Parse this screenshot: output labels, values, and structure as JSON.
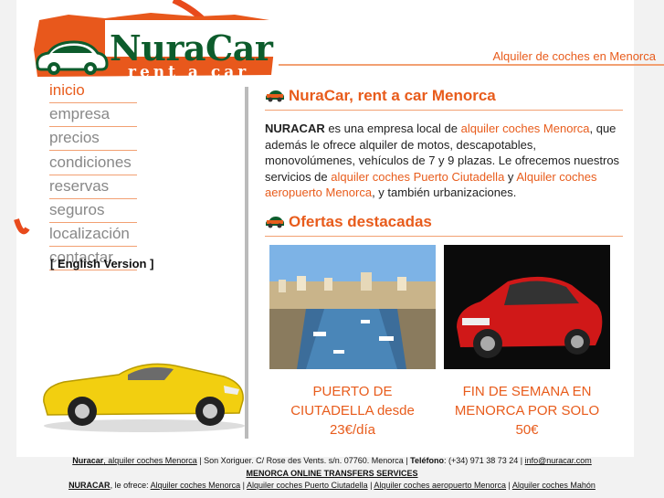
{
  "brand": {
    "name": "NuraCar",
    "subtitle": "rent a car"
  },
  "header": {
    "tagline": "Alquiler de coches en Menorca"
  },
  "menu": {
    "items": [
      {
        "label": "inicio",
        "active": true
      },
      {
        "label": "empresa",
        "active": false
      },
      {
        "label": "precios",
        "active": false
      },
      {
        "label": "condiciones",
        "active": false
      },
      {
        "label": "reservas",
        "active": false
      },
      {
        "label": "seguros",
        "active": false
      },
      {
        "label": "localización",
        "active": false
      },
      {
        "label": "contactar",
        "active": false
      }
    ],
    "english": "[ English Version ]"
  },
  "main": {
    "title": "NuraCar, rent a car Menorca",
    "intro": {
      "brand": "NURACAR",
      "t1": " es una empresa local de ",
      "l1": "alquiler coches Menorca",
      "t2": ", que además le ofrece alquiler de motos, descapotables, monovolúmenes, vehículos de 7 y 9 plazas. Le ofrecemos nuestros servicios de ",
      "l2": "alquiler coches Puerto Ciutadella",
      "t3": " y ",
      "l3": "Alquiler coches aeropuerto Menorca",
      "t4": ", y también urbanizaciones."
    }
  },
  "offers": {
    "title": "Ofertas destacadas",
    "items": [
      {
        "line1": "PUERTO DE",
        "line2": "CIUTADELLA desde",
        "price": "23€/día"
      },
      {
        "line1": "FIN DE SEMANA EN",
        "line2": "MENORCA POR SOLO",
        "price": "50€"
      }
    ]
  },
  "footer": {
    "line1": {
      "brand_link": "Nuracar",
      "brand_rest": ", alquiler coches Menorca",
      "address": " | Son Xoriguer. C/ Rose des Vents. s/n. 07760. Menorca | ",
      "phone_label": "Teléfono",
      "phone": ": (+34) 971 38 73 24 | ",
      "email": "info@nuracar.com"
    },
    "line2": "MENORCA ONLINE TRANSFERS SERVICES",
    "line3": {
      "brand": "NURACAR",
      "offers": ", le ofrece: ",
      "links": [
        "Alquiler coches Menorca",
        "Alquiler coches Puerto Ciutadella",
        "Alquiler coches aeropuerto Menorca",
        "Alquiler coches Mahón"
      ]
    }
  },
  "colors": {
    "accent": "#e85c1c",
    "brand_green": "#0d5c2c",
    "menu_text": "#888888"
  }
}
